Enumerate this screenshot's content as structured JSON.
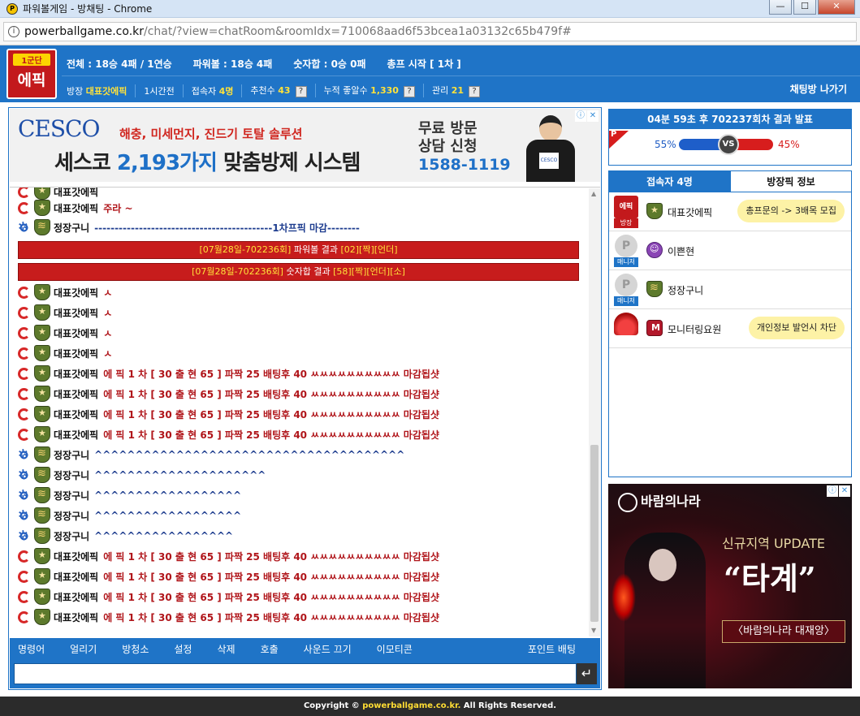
{
  "window": {
    "title": "파워볼게임 - 방채팅 - Chrome",
    "url_host": "powerballgame.co.kr",
    "url_path": "/chat/?view=chatRoom&roomIdx=710068aad6f53bcea1a03132c65b479f#"
  },
  "header": {
    "logo_line1": "1군단",
    "logo_line2": "에픽",
    "stats": [
      "전체 : 18승 4패 / 1연승",
      "파워볼 : 18승 4패",
      "숫자합 : 0승 0패",
      "총프 시작 [ 1차 ]"
    ],
    "owner_label": "방장",
    "owner_value": "대표갓에픽",
    "time_ago": "1시간전",
    "viewers_label": "접속자",
    "viewers_value": "4명",
    "recommend_label": "추천수",
    "recommend_value": "43",
    "likes_label": "누적 좋알수",
    "likes_value": "1,330",
    "manage_label": "관리",
    "manage_value": "21",
    "qmark": "?",
    "leave": "채팅방 나가기"
  },
  "ad_top": {
    "brand": "CESCO",
    "sub": "해충, 미세먼지, 진드기 토탈 솔루션",
    "main_a": "세스코 ",
    "main_b": "2,193가지",
    "main_c": " 맞춤방제 시스템",
    "right1a": "무료 방문",
    "right1b": "상담 신청",
    "phone": "1588-1119",
    "badge": "CESCO",
    "info": "ⓘ",
    "close": "✕"
  },
  "chat": {
    "partial_top": {
      "nick": "대표갓에픽",
      "text": "주라 ~"
    },
    "msg2": {
      "nick": "정장구니",
      "text": "--------------------------------------------1차프픽 마감--------"
    },
    "result1": {
      "date": "[07월28일-702236회]",
      "label": " 파워볼 결과 ",
      "n": "[02]",
      "a": "[짝]",
      "b": "[언더]"
    },
    "result2": {
      "date": "[07월28일-702236회]",
      "label": " 숫자합 결과 ",
      "n": "[58]",
      "a": "[짝]",
      "b": "[언더]",
      "c": "[소]"
    },
    "messages": [
      {
        "nick": "대표갓에픽",
        "text": "ㅅ"
      },
      {
        "nick": "대표갓에픽",
        "text": "ㅅ"
      },
      {
        "nick": "대표갓에픽",
        "text": "ㅅ"
      },
      {
        "nick": "대표갓에픽",
        "text": "ㅅ"
      },
      {
        "nick": "대표갓에픽",
        "text": "에 픽 1 차 [ 30 출 현 65 ] 파짝 25 배팅후 40 ㅆㅆㅆㅆㅆㅆㅆㅆㅆㅆ 마감됩샷"
      },
      {
        "nick": "대표갓에픽",
        "text": "에 픽 1 차 [ 30 출 현 65 ] 파짝 25 배팅후 40 ㅆㅆㅆㅆㅆㅆㅆㅆㅆㅆ 마감됩샷"
      },
      {
        "nick": "대표갓에픽",
        "text": "에 픽 1 차 [ 30 출 현 65 ] 파짝 25 배팅후 40 ㅆㅆㅆㅆㅆㅆㅆㅆㅆㅆ 마감됩샷"
      },
      {
        "nick": "대표갓에픽",
        "text": "에 픽 1 차 [ 30 출 현 65 ] 파짝 25 배팅후 40 ㅆㅆㅆㅆㅆㅆㅆㅆㅆㅆ 마감됩샷"
      },
      {
        "nick": "정장구니",
        "text": "^^^^^^^^^^^^^^^^^^^^^^^^^^^^^^^^^^^^^^"
      },
      {
        "nick": "정장구니",
        "text": "^^^^^^^^^^^^^^^^^^^^^"
      },
      {
        "nick": "정장구니",
        "text": "^^^^^^^^^^^^^^^^^^"
      },
      {
        "nick": "정장구니",
        "text": "^^^^^^^^^^^^^^^^^^"
      },
      {
        "nick": "정장구니",
        "text": "^^^^^^^^^^^^^^^^^"
      },
      {
        "nick": "대표갓에픽",
        "text": "에 픽 1 차 [ 30 출 현 65 ] 파짝 25 배팅후 40 ㅆㅆㅆㅆㅆㅆㅆㅆㅆㅆ 마감됩샷"
      },
      {
        "nick": "대표갓에픽",
        "text": "에 픽 1 차 [ 30 출 현 65 ] 파짝 25 배팅후 40 ㅆㅆㅆㅆㅆㅆㅆㅆㅆㅆ 마감됩샷"
      },
      {
        "nick": "대표갓에픽",
        "text": "에 픽 1 차 [ 30 출 현 65 ] 파짝 25 배팅후 40 ㅆㅆㅆㅆㅆㅆㅆㅆㅆㅆ 마감됩샷"
      },
      {
        "nick": "대표갓에픽",
        "text": "에 픽 1 차 [ 30 출 현 65 ] 파짝 25 배팅후 40 ㅆㅆㅆㅆㅆㅆㅆㅆㅆㅆ 마감됩샷"
      }
    ]
  },
  "toolbar": {
    "items": [
      "명령어",
      "얼리기",
      "방청소",
      "설정",
      "삭제",
      "호출",
      "사운드 끄기",
      "이모티콘"
    ],
    "point": "포인트 배팅",
    "send": "↵"
  },
  "timer": {
    "text": "04분 59초 후 702237회차 결과 발표",
    "flag": "P",
    "left_pct": "55%",
    "right_pct": "45%",
    "left_share": 0.55,
    "vs": "VS"
  },
  "users": {
    "tab_active": "접속자 4명",
    "tab_other": "방장픽 정보",
    "list": [
      {
        "face": "에픽",
        "role": "방장",
        "name": "대표갓에픽",
        "bubble": "총프문의 -> 3배목 모집"
      },
      {
        "face": "P",
        "role": "매니저",
        "name": "이쁜현",
        "bubble": ""
      },
      {
        "face": "P",
        "role": "매니저",
        "name": "정장구니",
        "bubble": ""
      },
      {
        "face": "",
        "role": "",
        "name": "모니터링요원",
        "bubble": "개인정보 발언시 차단"
      }
    ]
  },
  "ad_right": {
    "brand": "바람의나라",
    "update": "신규지역 UPDATE",
    "big": "“타계”",
    "pill": "〈바람의나라 대재앙〉",
    "info": "ⓘ",
    "close": "✕"
  },
  "footer": {
    "pre": "Copyright © ",
    "site": "powerballgame.co.kr.",
    "post": " All Rights Reserved."
  }
}
